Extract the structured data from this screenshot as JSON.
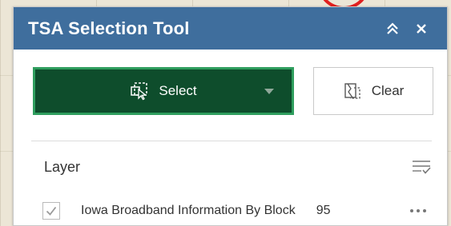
{
  "panel": {
    "title": "TSA Selection Tool",
    "header_color": "#3f6e9d",
    "icons": {
      "collapse": "double-chevron-up-icon",
      "close": "close-icon"
    }
  },
  "toolbar": {
    "select_label": "Select",
    "select_icon": "select-cursor-icon",
    "select_color": "#0e4d2c",
    "clear_label": "Clear",
    "clear_icon": "clear-selection-icon"
  },
  "layers": {
    "title": "Layer",
    "filter_icon": "filter-list-icon",
    "items": [
      {
        "name": "Iowa Broadband Information By Block",
        "count": "95",
        "checked": true,
        "menu_icon": "more-icon"
      }
    ]
  }
}
